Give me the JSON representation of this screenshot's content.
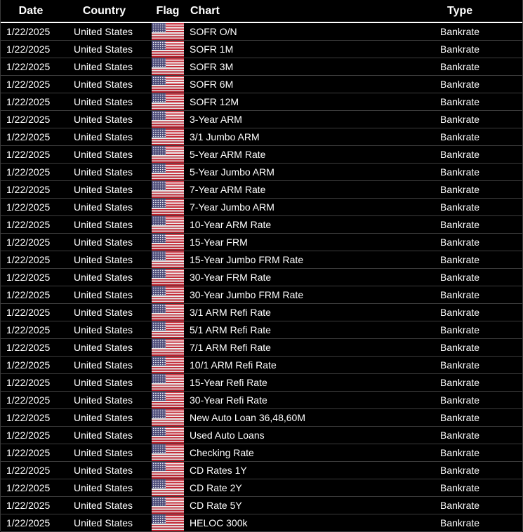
{
  "table": {
    "headers": {
      "date": "Date",
      "country": "Country",
      "flag": "Flag",
      "chart": "Chart",
      "type": "Type"
    },
    "flag_icon": "us-flag-icon",
    "colors": {
      "background": "#000000",
      "text": "#ffffff",
      "grid": "#3c3c3c",
      "flag_red": "#c8202f",
      "flag_blue": "#3c3b6e"
    },
    "rows": [
      {
        "date": "1/22/2025",
        "country": "United States",
        "chart": "SOFR O/N",
        "type": "Bankrate"
      },
      {
        "date": "1/22/2025",
        "country": "United States",
        "chart": "SOFR 1M",
        "type": "Bankrate"
      },
      {
        "date": "1/22/2025",
        "country": "United States",
        "chart": "SOFR 3M",
        "type": "Bankrate"
      },
      {
        "date": "1/22/2025",
        "country": "United States",
        "chart": "SOFR 6M",
        "type": "Bankrate"
      },
      {
        "date": "1/22/2025",
        "country": "United States",
        "chart": "SOFR 12M",
        "type": "Bankrate"
      },
      {
        "date": "1/22/2025",
        "country": "United States",
        "chart": "3-Year ARM",
        "type": "Bankrate"
      },
      {
        "date": "1/22/2025",
        "country": "United States",
        "chart": "3/1 Jumbo ARM",
        "type": "Bankrate"
      },
      {
        "date": "1/22/2025",
        "country": "United States",
        "chart": "5-Year ARM Rate",
        "type": "Bankrate"
      },
      {
        "date": "1/22/2025",
        "country": "United States",
        "chart": "5-Year Jumbo ARM",
        "type": "Bankrate"
      },
      {
        "date": "1/22/2025",
        "country": "United States",
        "chart": "7-Year ARM Rate",
        "type": "Bankrate"
      },
      {
        "date": "1/22/2025",
        "country": "United States",
        "chart": "7-Year Jumbo ARM",
        "type": "Bankrate"
      },
      {
        "date": "1/22/2025",
        "country": "United States",
        "chart": "10-Year ARM Rate",
        "type": "Bankrate"
      },
      {
        "date": "1/22/2025",
        "country": "United States",
        "chart": "15-Year FRM",
        "type": "Bankrate"
      },
      {
        "date": "1/22/2025",
        "country": "United States",
        "chart": "15-Year Jumbo FRM Rate",
        "type": "Bankrate"
      },
      {
        "date": "1/22/2025",
        "country": "United States",
        "chart": "30-Year FRM Rate",
        "type": "Bankrate"
      },
      {
        "date": "1/22/2025",
        "country": "United States",
        "chart": "30-Year Jumbo FRM Rate",
        "type": "Bankrate"
      },
      {
        "date": "1/22/2025",
        "country": "United States",
        "chart": "3/1 ARM Refi Rate",
        "type": "Bankrate"
      },
      {
        "date": "1/22/2025",
        "country": "United States",
        "chart": "5/1 ARM Refi Rate",
        "type": "Bankrate"
      },
      {
        "date": "1/22/2025",
        "country": "United States",
        "chart": "7/1 ARM Refi Rate",
        "type": "Bankrate"
      },
      {
        "date": "1/22/2025",
        "country": "United States",
        "chart": "10/1 ARM Refi Rate",
        "type": "Bankrate"
      },
      {
        "date": "1/22/2025",
        "country": "United States",
        "chart": "15-Year Refi Rate",
        "type": "Bankrate"
      },
      {
        "date": "1/22/2025",
        "country": "United States",
        "chart": "30-Year Refi Rate",
        "type": "Bankrate"
      },
      {
        "date": "1/22/2025",
        "country": "United States",
        "chart": "New Auto Loan 36,48,60M",
        "type": "Bankrate"
      },
      {
        "date": "1/22/2025",
        "country": "United States",
        "chart": "Used Auto Loans",
        "type": "Bankrate"
      },
      {
        "date": "1/22/2025",
        "country": "United States",
        "chart": "Checking Rate",
        "type": "Bankrate"
      },
      {
        "date": "1/22/2025",
        "country": "United States",
        "chart": "CD Rates 1Y",
        "type": "Bankrate"
      },
      {
        "date": "1/22/2025",
        "country": "United States",
        "chart": "CD Rate 2Y",
        "type": "Bankrate"
      },
      {
        "date": "1/22/2025",
        "country": "United States",
        "chart": "CD Rate 5Y",
        "type": "Bankrate"
      },
      {
        "date": "1/22/2025",
        "country": "United States",
        "chart": "HELOC 300k",
        "type": "Bankrate"
      }
    ]
  }
}
